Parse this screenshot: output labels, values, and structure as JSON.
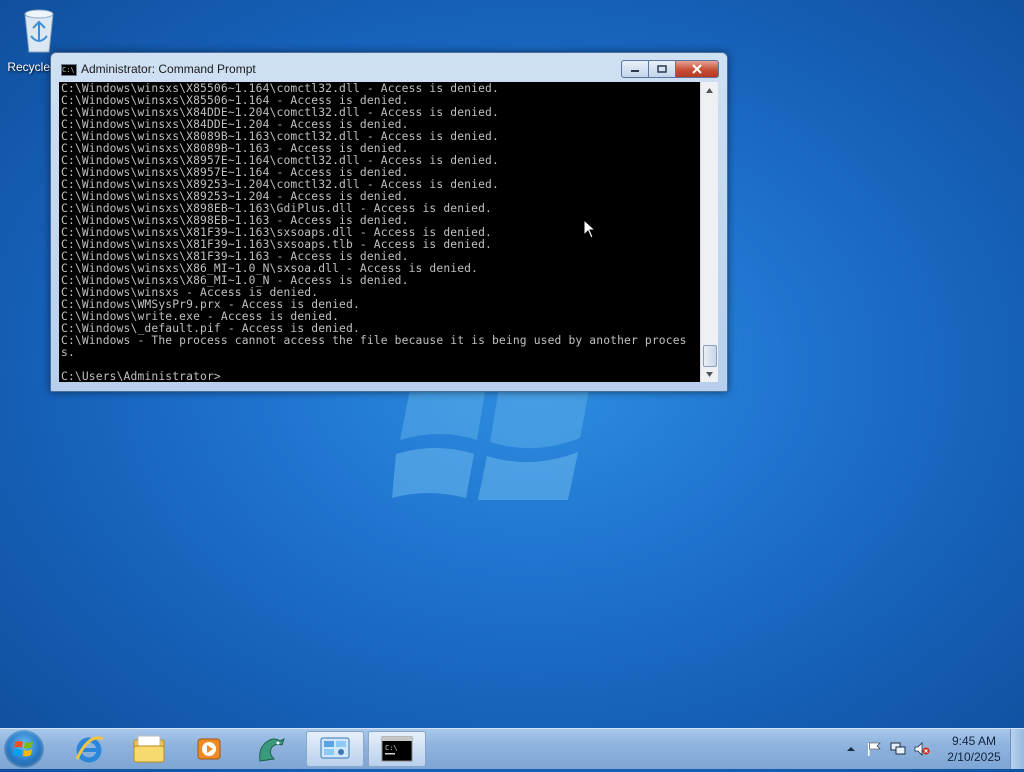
{
  "desktop": {
    "icons": [
      {
        "label": "Recycle Bin",
        "icon": "recycle-bin-icon"
      }
    ]
  },
  "window": {
    "title": "Administrator: Command Prompt",
    "icon": "cmd-icon",
    "controls": {
      "minimize": "minimize-icon",
      "maximize": "maximize-icon",
      "close": "close-icon"
    }
  },
  "console": {
    "lines": [
      "C:\\Windows\\winsxs\\X85506~1.164\\comctl32.dll - Access is denied.",
      "C:\\Windows\\winsxs\\X85506~1.164 - Access is denied.",
      "C:\\Windows\\winsxs\\X84DDE~1.204\\comctl32.dll - Access is denied.",
      "C:\\Windows\\winsxs\\X84DDE~1.204 - Access is denied.",
      "C:\\Windows\\winsxs\\X8089B~1.163\\comctl32.dll - Access is denied.",
      "C:\\Windows\\winsxs\\X8089B~1.163 - Access is denied.",
      "C:\\Windows\\winsxs\\X8957E~1.164\\comctl32.dll - Access is denied.",
      "C:\\Windows\\winsxs\\X8957E~1.164 - Access is denied.",
      "C:\\Windows\\winsxs\\X89253~1.204\\comctl32.dll - Access is denied.",
      "C:\\Windows\\winsxs\\X89253~1.204 - Access is denied.",
      "C:\\Windows\\winsxs\\X898EB~1.163\\GdiPlus.dll - Access is denied.",
      "C:\\Windows\\winsxs\\X898EB~1.163 - Access is denied.",
      "C:\\Windows\\winsxs\\X81F39~1.163\\sxsoaps.dll - Access is denied.",
      "C:\\Windows\\winsxs\\X81F39~1.163\\sxsoaps.tlb - Access is denied.",
      "C:\\Windows\\winsxs\\X81F39~1.163 - Access is denied.",
      "C:\\Windows\\winsxs\\X86_MI~1.0_N\\sxsoa.dll - Access is denied.",
      "C:\\Windows\\winsxs\\X86_MI~1.0_N - Access is denied.",
      "C:\\Windows\\winsxs - Access is denied.",
      "C:\\Windows\\WMSysPr9.prx - Access is denied.",
      "C:\\Windows\\write.exe - Access is denied.",
      "C:\\Windows\\_default.pif - Access is denied.",
      "C:\\Windows - The process cannot access the file because it is being used by another process.",
      "",
      "C:\\Users\\Administrator>"
    ]
  },
  "taskbar": {
    "start_icon": "windows-start-icon",
    "pinned": [
      {
        "name": "internet-explorer-icon"
      },
      {
        "name": "file-explorer-icon"
      },
      {
        "name": "media-player-icon"
      },
      {
        "name": "dragon-app-icon"
      },
      {
        "name": "control-panel-icon"
      },
      {
        "name": "cmd-taskbar-icon"
      }
    ],
    "tray": {
      "icons": [
        "show-hidden-icons-arrow",
        "action-center-flag-icon",
        "network-icon",
        "volume-muted-icon"
      ]
    },
    "clock": {
      "time": "9:45 AM",
      "date": "2/10/2025"
    }
  }
}
